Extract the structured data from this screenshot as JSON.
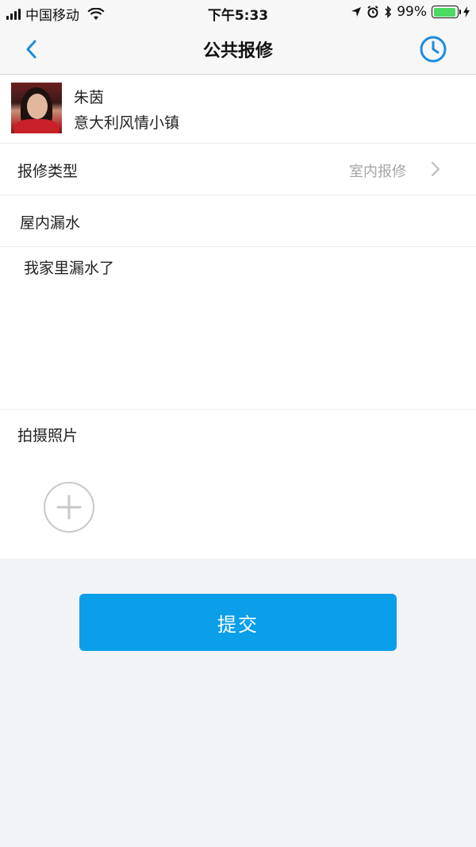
{
  "status_bar": {
    "carrier": "中国移动",
    "time": "下午5:33",
    "battery_percent": "99%",
    "battery_level": 0.99
  },
  "nav": {
    "title": "公共报修",
    "back_icon": "chevron-left-icon",
    "history_icon": "clock-icon"
  },
  "user": {
    "name": "朱茵",
    "community": "意大利风情小镇"
  },
  "repair_type": {
    "label": "报修类型",
    "value": "室内报修"
  },
  "repair_title": "屋内漏水",
  "repair_description": "我家里漏水了",
  "photos": {
    "label": "拍摄照片",
    "add_icon": "plus-circle-icon"
  },
  "submit_label": "提交",
  "colors": {
    "accent": "#0a9fe8",
    "nav_icon": "#1a8ce0",
    "battery": "#4cd964",
    "background": "#f2f3f7"
  }
}
